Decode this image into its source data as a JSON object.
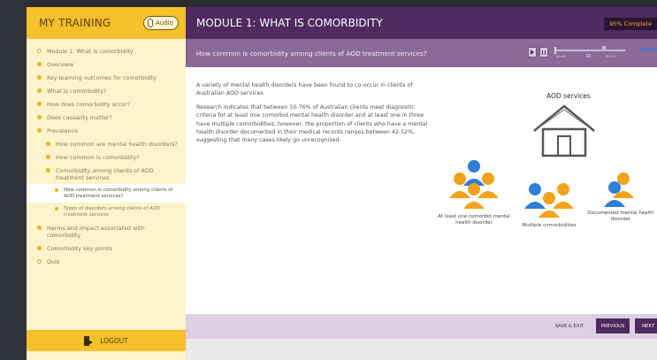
{
  "sidebar": {
    "title": "MY TRAINING",
    "audio_label": "Audio",
    "items": [
      {
        "label": "Module 1: What is comorbidity",
        "level": 1,
        "marker": "hollow"
      },
      {
        "label": "Overview",
        "level": 1,
        "marker": "filled"
      },
      {
        "label": "Key learning outcomes for comorbidity",
        "level": 1,
        "marker": "filled"
      },
      {
        "label": "What is comorbidity?",
        "level": 1,
        "marker": "filled"
      },
      {
        "label": "How does comorbidity occur?",
        "level": 1,
        "marker": "filled"
      },
      {
        "label": "Does causality matter?",
        "level": 1,
        "marker": "filled"
      },
      {
        "label": "Prevalence",
        "level": 1,
        "marker": "filled"
      },
      {
        "label": "How common are mental health disorders?",
        "level": 2,
        "marker": "filled"
      },
      {
        "label": "How common is comorbidity?",
        "level": 2,
        "marker": "filled"
      },
      {
        "label": "Comorbidity among clients of AOD treatment services",
        "level": 2,
        "marker": "filled"
      },
      {
        "label": "How common is comorbidity among clients of AOD treatment services?",
        "level": 3,
        "marker": "filled",
        "active": true
      },
      {
        "label": "Types of disorders among clients of AOD treatment services",
        "level": 3,
        "marker": "filled"
      },
      {
        "label": "Harms and impact associated with comorbidity",
        "level": 1,
        "marker": "filled"
      },
      {
        "label": "Comorbidity key points",
        "level": 1,
        "marker": "filled"
      },
      {
        "label": "Quiz",
        "level": 1,
        "marker": "hollow"
      }
    ],
    "logout_label": "LOGOUT"
  },
  "header": {
    "module_title": "MODULE 1: WHAT IS COMORBIDITY",
    "progress_text": "95% Complete"
  },
  "subheader": {
    "question": "How common is comorbidity among clients of AOD treatment services?",
    "time_elapsed": "00:00",
    "time_total": "00:22"
  },
  "content": {
    "paragraphs": [
      "A variety of mental health disorders have been found to co-occur in clients of Australian AOD services.",
      "Research indicates that between 50-76% of Australian clients meet diagnostic criteria for at least one comorbid mental health disorder and at least one in three have multiple comorbidities; however, the proportion of clients who have a mental health disorder documented in their medical records ranges between 42-52%, suggesting that many cases likely go unrecognised."
    ],
    "infographic": {
      "title": "AOD services",
      "groups": [
        {
          "label": "At least one comorbid mental health disorder"
        },
        {
          "label": "Multiple comorbidities"
        },
        {
          "label": "Documented mental health disorder"
        }
      ]
    }
  },
  "footer": {
    "save_exit": "SAVE & EXIT",
    "previous": "PREVIOUS",
    "next": "NEXT"
  },
  "colors": {
    "sidebar_yellow": "#f6bf2c",
    "sidebar_bg": "#fdf4cc",
    "header_purple": "#4e2a5e",
    "subheader_purple": "#8b6a97",
    "person_blue": "#2f7ed8",
    "person_orange": "#f2a21c"
  }
}
